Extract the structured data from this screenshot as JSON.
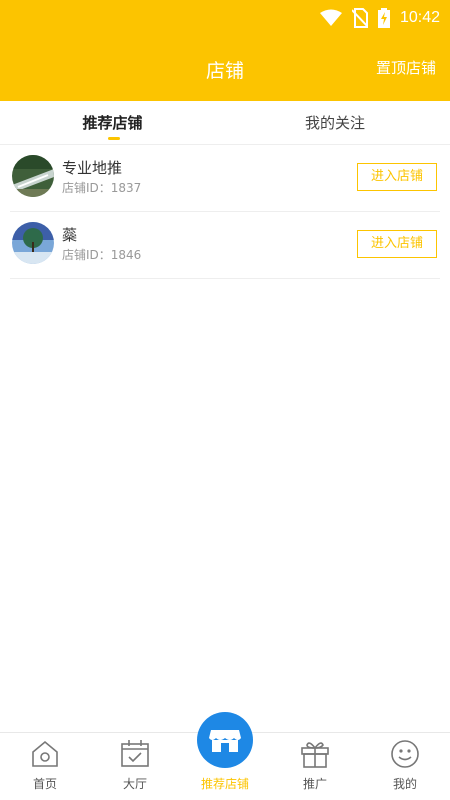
{
  "status_bar": {
    "time": "10:42"
  },
  "header": {
    "title": "店铺",
    "top_store_label": "置顶店铺"
  },
  "tabs": [
    {
      "label": "推荐店铺",
      "active": true
    },
    {
      "label": "我的关注",
      "active": false
    }
  ],
  "shops": [
    {
      "name": "专业地推",
      "id_text": "店铺ID：1837",
      "button_label": "进入店铺"
    },
    {
      "name": "蘂",
      "id_text": "店铺ID：1846",
      "button_label": "进入店铺"
    }
  ],
  "bottom_nav": [
    {
      "label": "首页",
      "icon": "home-icon"
    },
    {
      "label": "大厅",
      "icon": "hall-icon"
    },
    {
      "label": "推荐店铺",
      "icon": "store-icon",
      "active": true
    },
    {
      "label": "推广",
      "icon": "gift-icon"
    },
    {
      "label": "我的",
      "icon": "smile-icon"
    }
  ],
  "colors": {
    "accent": "#fcc400",
    "fab": "#1e88e5"
  }
}
